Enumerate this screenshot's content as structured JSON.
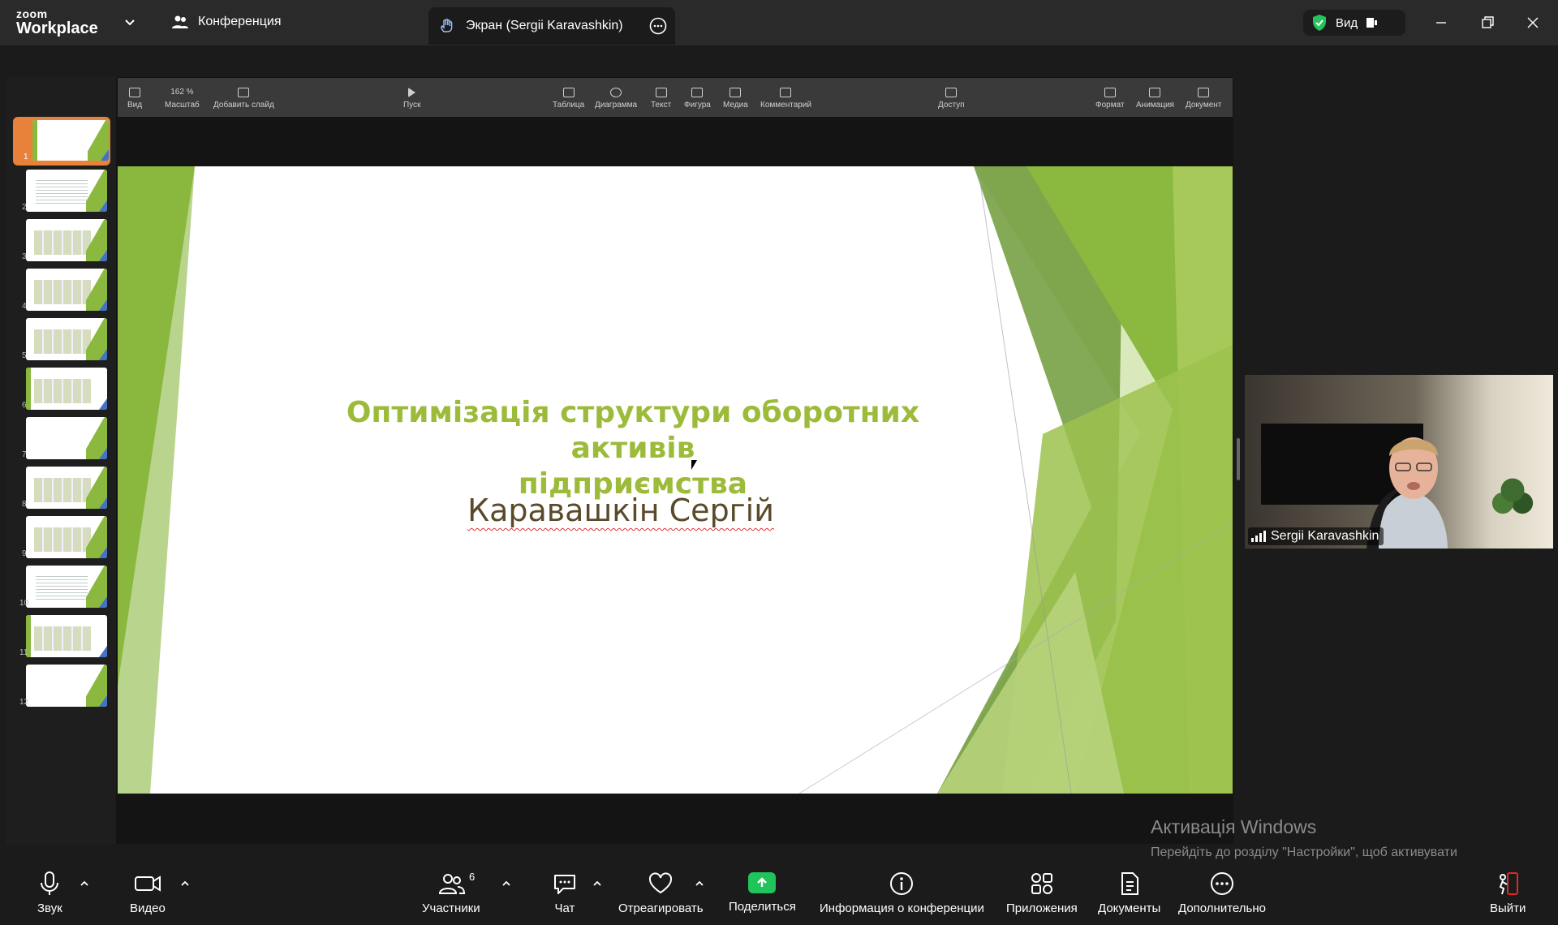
{
  "titlebar": {
    "logo_small": "zoom",
    "logo_big": "Workplace",
    "tab_conference": "Конференция",
    "tab_screen": "Экран (Sergii Karavashkin)",
    "view_label": "Вид"
  },
  "keynote_toolbar": {
    "view": "Вид",
    "zoom_value": "162 %",
    "zoom": "Масштаб",
    "add_slide": "Добавить слайд",
    "play": "Пуск",
    "table": "Таблица",
    "chart": "Диаграмма",
    "text": "Текст",
    "shape": "Фигура",
    "media": "Медиа",
    "comment": "Комментарий",
    "share": "Доступ",
    "format": "Формат",
    "animate": "Анимация",
    "document": "Документ"
  },
  "thumbnails": {
    "numbers": [
      "1",
      "2",
      "3",
      "4",
      "5",
      "6",
      "7",
      "8",
      "9",
      "10",
      "11",
      "12"
    ],
    "selected": "1"
  },
  "slide": {
    "title_line1": "Оптимізація структури оборотних активів",
    "title_line2": "підприємства",
    "author": "Каравашкін Сергій",
    "accent_color": "#8bb83f"
  },
  "camera": {
    "name": "Sergii Karavashkin"
  },
  "watermark": {
    "title": "Активація Windows",
    "text": "Перейдіть до розділу \"Настройки\", щоб активувати Windows."
  },
  "controls": {
    "audio": "Звук",
    "video": "Видео",
    "participants": "Участники",
    "participants_count": "6",
    "chat": "Чат",
    "react": "Отреагировать",
    "share": "Поделиться",
    "info": "Информация о конференции",
    "apps": "Приложения",
    "docs": "Документы",
    "more": "Дополнительно",
    "leave": "Выйти",
    "share_color": "#21c35b",
    "leave_color": "#e02828"
  }
}
